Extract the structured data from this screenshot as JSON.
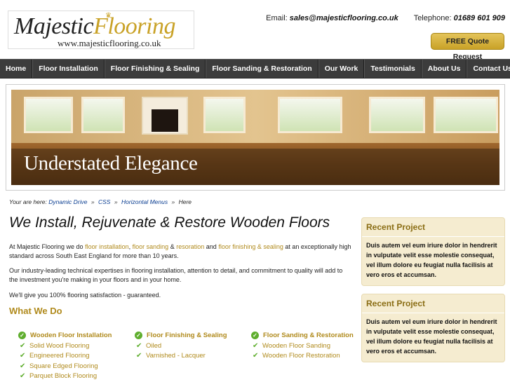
{
  "header": {
    "logo_word1": "Majestic",
    "logo_word2": "Flooring",
    "logo_url": "www.majesticflooring.co.uk",
    "email_label": "Email:",
    "email_value": "sales@majesticflooring.co.uk",
    "phone_label": "Telephone:",
    "phone_value": "01689 601 909",
    "quote_button": "FREE Quote Request"
  },
  "nav": {
    "items": [
      {
        "label": "Home"
      },
      {
        "label": "Floor Installation"
      },
      {
        "label": "Floor Finishing & Sealing"
      },
      {
        "label": "Floor Sanding & Restoration"
      },
      {
        "label": "Our Work"
      },
      {
        "label": "Testimonials"
      },
      {
        "label": "About Us"
      },
      {
        "label": "Contact Us"
      }
    ]
  },
  "banner": {
    "caption": "Understated Elegance"
  },
  "breadcrumb": {
    "prefix": "Your are here:",
    "links": [
      "Dynamic Drive",
      "CSS",
      "Horizontal Menus"
    ],
    "current": "Here",
    "separator": "»"
  },
  "main": {
    "title": "We Install, Rejuvenate & Restore Wooden Floors",
    "para1": {
      "start": "At Majestic Flooring we do",
      "link1": "floor installation",
      "comma": ",",
      "link2": "floor sanding",
      "amp": "&",
      "link3": "resoration",
      "and": "and",
      "link4": "floor finishing & sealing",
      "end": "at an exceptionally high standard across South East England for more than 10 years."
    },
    "para2": "Our industry-leading technical expertises in flooring installation, attention to detail, and commitment to quality will add to the investment you're making in your floors and in your home.",
    "para3": "We'll give you 100% flooring satisfaction - guaranteed.",
    "what_we_do_title": "What We Do",
    "columns": [
      {
        "heading": "Wooden Floor Installation",
        "items": [
          "Solid Wood Flooring",
          "Engineered Flooring",
          "Square Edged Flooring",
          "Parquet Block Flooring"
        ]
      },
      {
        "heading": "Floor Finishing & Sealing",
        "items": [
          "Oiled",
          "Varnished - Lacquer"
        ]
      },
      {
        "heading": "Floor Sanding & Restoration",
        "items": [
          "Wooden Floor Sanding",
          "Wooden Floor Restoration"
        ]
      }
    ]
  },
  "sidebar": {
    "boxes": [
      {
        "title": "Recent Project",
        "text": "Duis autem vel eum iriure dolor in hendrerit in vulputate velit esse molestie consequat, vel illum dolore eu feugiat nulla facilisis at vero eros et accumsan."
      },
      {
        "title": "Recent Project",
        "text": "Duis autem vel eum iriure dolor in hendrerit in vulputate velit esse molestie consequat, vel illum dolore eu feugiat nulla facilisis at vero eros et accumsan."
      }
    ]
  },
  "colors": {
    "accent_gold": "#b08a1c",
    "nav_bg": "#3c3c3c",
    "sidebar_bg": "#f5ecd0",
    "check_green": "#5fae2e"
  }
}
